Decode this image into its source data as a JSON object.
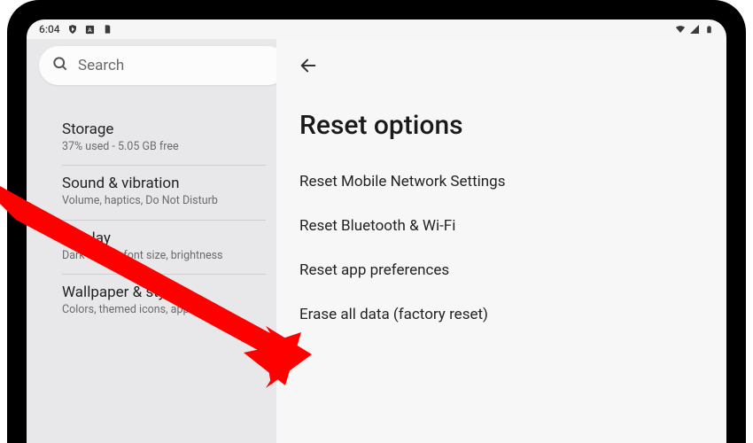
{
  "status_bar": {
    "time": "6:04",
    "icons_left": [
      "shield",
      "square-a",
      "page"
    ],
    "icons_right": [
      "wifi",
      "cell",
      "battery"
    ]
  },
  "sidebar": {
    "search_placeholder": "Search",
    "items": [
      {
        "title": "Storage",
        "sub": "37% used - 5.05 GB free"
      },
      {
        "title": "Sound & vibration",
        "sub": "Volume, haptics, Do Not Disturb"
      },
      {
        "title": "Display",
        "sub": "Dark theme, font size, brightness"
      },
      {
        "title": "Wallpaper & style",
        "sub": "Colors, themed icons, app grid"
      }
    ]
  },
  "main": {
    "title": "Reset options",
    "options": [
      "Reset Mobile Network Settings",
      "Reset Bluetooth & Wi-Fi",
      "Reset app preferences",
      "Erase all data (factory reset)"
    ]
  },
  "annotation": {
    "arrow_color": "#ff0000",
    "target_option_index": 3
  }
}
